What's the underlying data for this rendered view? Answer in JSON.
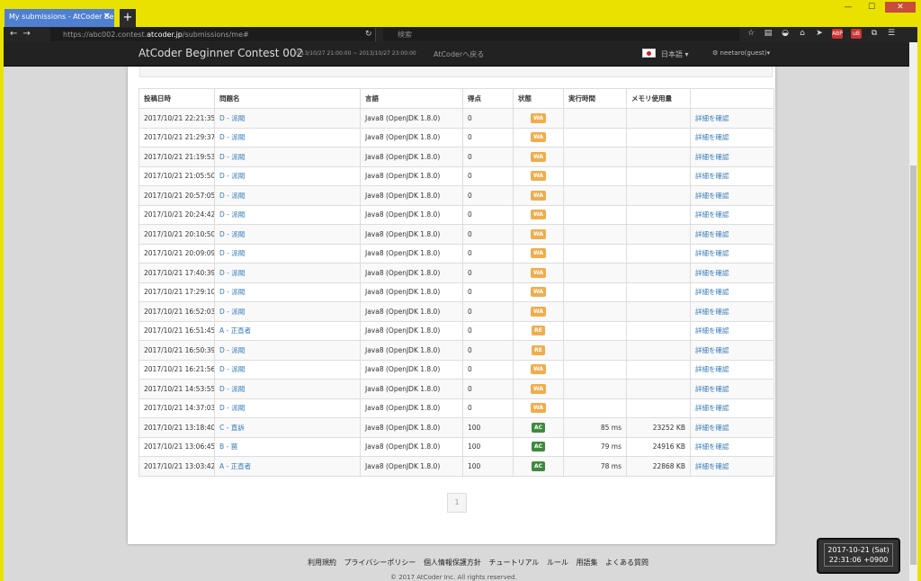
{
  "browser": {
    "tab_title": "My submissions - AtCoder Be",
    "url_prefix": "https://abc002.contest.",
    "url_domain": "atcoder.jp",
    "url_path": "/submissions/me#",
    "search_placeholder": "検索"
  },
  "navbar": {
    "brand": "AtCoder Beginner Contest 002",
    "contest_period": "2013/10/27 21:00:00 ~ 2013/10/27 23:00:00",
    "back_link": "AtCoderへ戻る",
    "language": "日本語",
    "user": "neetaro(guest)"
  },
  "table": {
    "headers": [
      "投稿日時",
      "問題名",
      "言語",
      "得点",
      "状態",
      "実行時間",
      "メモリ使用量",
      ""
    ],
    "rows": [
      {
        "date": "2017/10/21 22:21:35",
        "problem": "D - 派閥",
        "lang": "Java8 (OpenJDK 1.8.0)",
        "score": "0",
        "status": "WA",
        "time": "",
        "memory": "",
        "detail": "詳細を確認"
      },
      {
        "date": "2017/10/21 21:29:37",
        "problem": "D - 派閥",
        "lang": "Java8 (OpenJDK 1.8.0)",
        "score": "0",
        "status": "WA",
        "time": "",
        "memory": "",
        "detail": "詳細を確認"
      },
      {
        "date": "2017/10/21 21:19:53",
        "problem": "D - 派閥",
        "lang": "Java8 (OpenJDK 1.8.0)",
        "score": "0",
        "status": "WA",
        "time": "",
        "memory": "",
        "detail": "詳細を確認"
      },
      {
        "date": "2017/10/21 21:05:50",
        "problem": "D - 派閥",
        "lang": "Java8 (OpenJDK 1.8.0)",
        "score": "0",
        "status": "WA",
        "time": "",
        "memory": "",
        "detail": "詳細を確認"
      },
      {
        "date": "2017/10/21 20:57:05",
        "problem": "D - 派閥",
        "lang": "Java8 (OpenJDK 1.8.0)",
        "score": "0",
        "status": "WA",
        "time": "",
        "memory": "",
        "detail": "詳細を確認"
      },
      {
        "date": "2017/10/21 20:24:42",
        "problem": "D - 派閥",
        "lang": "Java8 (OpenJDK 1.8.0)",
        "score": "0",
        "status": "WA",
        "time": "",
        "memory": "",
        "detail": "詳細を確認"
      },
      {
        "date": "2017/10/21 20:10:50",
        "problem": "D - 派閥",
        "lang": "Java8 (OpenJDK 1.8.0)",
        "score": "0",
        "status": "WA",
        "time": "",
        "memory": "",
        "detail": "詳細を確認"
      },
      {
        "date": "2017/10/21 20:09:09",
        "problem": "D - 派閥",
        "lang": "Java8 (OpenJDK 1.8.0)",
        "score": "0",
        "status": "WA",
        "time": "",
        "memory": "",
        "detail": "詳細を確認"
      },
      {
        "date": "2017/10/21 17:40:39",
        "problem": "D - 派閥",
        "lang": "Java8 (OpenJDK 1.8.0)",
        "score": "0",
        "status": "WA",
        "time": "",
        "memory": "",
        "detail": "詳細を確認"
      },
      {
        "date": "2017/10/21 17:29:10",
        "problem": "D - 派閥",
        "lang": "Java8 (OpenJDK 1.8.0)",
        "score": "0",
        "status": "WA",
        "time": "",
        "memory": "",
        "detail": "詳細を確認"
      },
      {
        "date": "2017/10/21 16:52:03",
        "problem": "D - 派閥",
        "lang": "Java8 (OpenJDK 1.8.0)",
        "score": "0",
        "status": "WA",
        "time": "",
        "memory": "",
        "detail": "詳細を確認"
      },
      {
        "date": "2017/10/21 16:51:45",
        "problem": "A - 正直者",
        "lang": "Java8 (OpenJDK 1.8.0)",
        "score": "0",
        "status": "RE",
        "time": "",
        "memory": "",
        "detail": "詳細を確認"
      },
      {
        "date": "2017/10/21 16:50:39",
        "problem": "D - 派閥",
        "lang": "Java8 (OpenJDK 1.8.0)",
        "score": "0",
        "status": "RE",
        "time": "",
        "memory": "",
        "detail": "詳細を確認"
      },
      {
        "date": "2017/10/21 16:21:56",
        "problem": "D - 派閥",
        "lang": "Java8 (OpenJDK 1.8.0)",
        "score": "0",
        "status": "WA",
        "time": "",
        "memory": "",
        "detail": "詳細を確認"
      },
      {
        "date": "2017/10/21 14:53:55",
        "problem": "D - 派閥",
        "lang": "Java8 (OpenJDK 1.8.0)",
        "score": "0",
        "status": "WA",
        "time": "",
        "memory": "",
        "detail": "詳細を確認"
      },
      {
        "date": "2017/10/21 14:37:03",
        "problem": "D - 派閥",
        "lang": "Java8 (OpenJDK 1.8.0)",
        "score": "0",
        "status": "WA",
        "time": "",
        "memory": "",
        "detail": "詳細を確認"
      },
      {
        "date": "2017/10/21 13:18:40",
        "problem": "C - 直訴",
        "lang": "Java8 (OpenJDK 1.8.0)",
        "score": "100",
        "status": "AC",
        "time": "85 ms",
        "memory": "23252 KB",
        "detail": "詳細を確認"
      },
      {
        "date": "2017/10/21 13:06:45",
        "problem": "B - 罠",
        "lang": "Java8 (OpenJDK 1.8.0)",
        "score": "100",
        "status": "AC",
        "time": "79 ms",
        "memory": "24916 KB",
        "detail": "詳細を確認"
      },
      {
        "date": "2017/10/21 13:03:42",
        "problem": "A - 正直者",
        "lang": "Java8 (OpenJDK 1.8.0)",
        "score": "100",
        "status": "AC",
        "time": "78 ms",
        "memory": "22868 KB",
        "detail": "詳細を確認"
      }
    ]
  },
  "pagination": {
    "current": "1"
  },
  "footer": {
    "links": [
      "利用規約",
      "プライバシーポリシー",
      "個人情報保護方針",
      "チュートリアル",
      "ルール",
      "用語集",
      "よくある質問"
    ],
    "copyright": "© 2017 AtCoder Inc. All rights reserved."
  },
  "clock": {
    "date": "2017-10-21 (Sat)",
    "time": "22:31:06 +0900"
  },
  "colors": {
    "wa": "#f0ad4e",
    "ac": "#3d8b3d",
    "link": "#337ab7",
    "tab": "#4e7fd1"
  }
}
